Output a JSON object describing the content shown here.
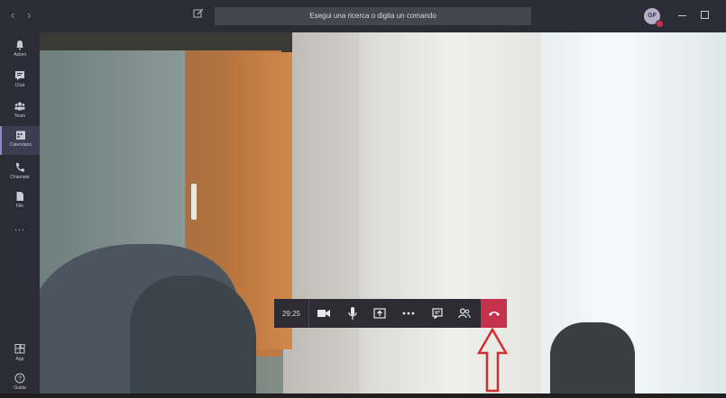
{
  "titlebar": {
    "back_icon": "chevron-left-icon",
    "forward_icon": "chevron-right-icon",
    "compose_icon": "new-chat-icon",
    "search_placeholder": "Esegui una ricerca o digita un comando",
    "avatar_initials": "GF",
    "avatar_status_color": "#c4314b"
  },
  "rail": {
    "items": [
      {
        "label": "Azioni",
        "icon": "bell-icon"
      },
      {
        "label": "Chat",
        "icon": "chat-icon"
      },
      {
        "label": "Team",
        "icon": "teams-icon"
      },
      {
        "label": "Calendario",
        "icon": "calendar-icon",
        "active": true
      },
      {
        "label": "Chiamate",
        "icon": "phone-icon"
      },
      {
        "label": "File",
        "icon": "file-icon"
      }
    ],
    "more": "...",
    "bottom": [
      {
        "label": "App",
        "icon": "apps-icon"
      },
      {
        "label": "Guida",
        "icon": "help-icon"
      }
    ]
  },
  "call": {
    "timer": "29:25",
    "hangup_color": "#c4314b",
    "controls": [
      "video-camera-icon",
      "microphone-icon",
      "share-screen-icon",
      "more-options-icon",
      "chat-icon",
      "participants-icon",
      "hang-up-icon"
    ]
  },
  "annotation": {
    "arrow_color": "#d32f2f"
  }
}
